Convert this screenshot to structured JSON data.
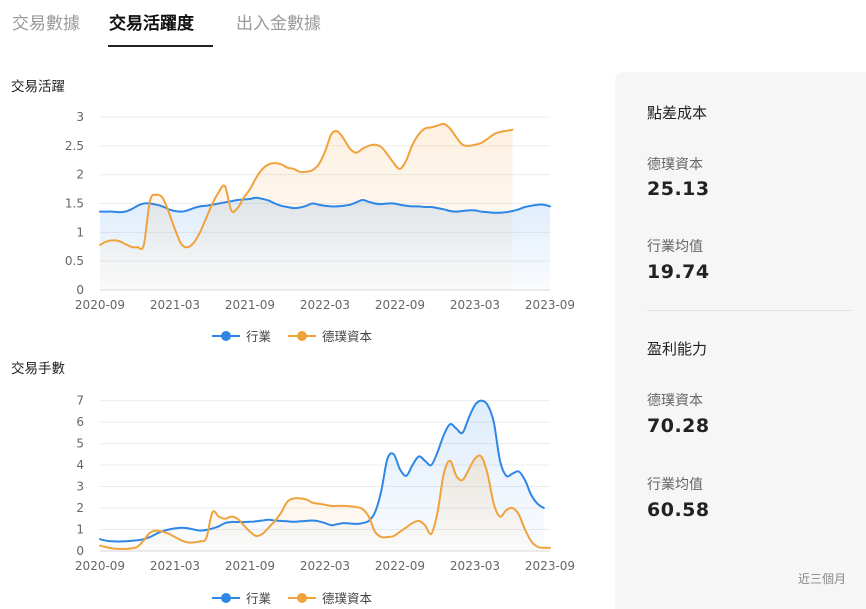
{
  "tabs": [
    {
      "label": "交易數據",
      "active": false
    },
    {
      "label": "交易活躍度",
      "active": true
    },
    {
      "label": "出入金數據",
      "active": false
    }
  ],
  "colors": {
    "industry": "#2e86e6",
    "company": "#f0a23c"
  },
  "charts": {
    "activity": {
      "title": "交易活躍"
    },
    "trades": {
      "title": "交易手數"
    }
  },
  "legend": {
    "industry": "行業",
    "company": "德璞資本"
  },
  "panel": {
    "spread": {
      "heading": "點差成本",
      "company_label": "德璞資本",
      "company_value": "25.13",
      "industry_label": "行業均值",
      "industry_value": "19.74"
    },
    "profit": {
      "heading": "盈利能力",
      "company_label": "德璞資本",
      "company_value": "70.28",
      "industry_label": "行業均值",
      "industry_value": "60.58"
    },
    "footer": "近三個月"
  },
  "chart_data": [
    {
      "type": "area",
      "title": "交易活躍",
      "x_ticks": [
        "2020-09",
        "2021-03",
        "2021-09",
        "2022-03",
        "2022-09",
        "2023-03",
        "2023-09"
      ],
      "y_ticks": [
        0,
        0.5,
        1,
        1.5,
        2,
        2.5,
        3
      ],
      "ylim": [
        0,
        3
      ],
      "x": [
        0,
        0.5,
        1,
        1.5,
        2,
        2.5,
        3,
        3.5,
        4,
        4.5,
        5,
        5.5,
        6,
        6.5,
        7,
        7.5,
        8,
        8.5,
        9,
        9.5,
        10,
        10.5,
        11,
        11.5,
        12,
        12.5,
        13,
        13.5,
        14,
        14.5,
        15,
        15.5,
        16,
        16.5,
        17,
        17.5,
        18,
        18.5,
        19,
        19.5,
        20,
        20.5,
        21,
        21.5,
        22,
        22.5,
        23,
        23.5,
        24,
        24.5,
        25,
        25.5,
        26,
        26.5,
        27,
        27.5,
        28,
        28.5,
        29,
        29.5,
        30,
        30.5,
        31,
        31.5,
        32,
        32.5,
        33,
        33.5,
        34,
        34.5,
        35,
        35.5,
        36
      ],
      "series": [
        {
          "name": "行業",
          "values": [
            1.36,
            1.36,
            1.36,
            1.35,
            1.36,
            1.4,
            1.46,
            1.5,
            1.5,
            1.48,
            1.45,
            1.4,
            1.37,
            1.36,
            1.38,
            1.42,
            1.45,
            1.46,
            1.48,
            1.5,
            1.52,
            1.54,
            1.56,
            1.57,
            1.58,
            1.6,
            1.58,
            1.55,
            1.5,
            1.46,
            1.44,
            1.42,
            1.43,
            1.46,
            1.5,
            1.48,
            1.46,
            1.45,
            1.45,
            1.46,
            1.48,
            1.52,
            1.56,
            1.53,
            1.5,
            1.49,
            1.5,
            1.5,
            1.48,
            1.46,
            1.45,
            1.45,
            1.44,
            1.44,
            1.42,
            1.4,
            1.37,
            1.36,
            1.37,
            1.38,
            1.38,
            1.36,
            1.35,
            1.34,
            1.34,
            1.35,
            1.37,
            1.4,
            1.44,
            1.46,
            1.48,
            1.48,
            1.45
          ]
        },
        {
          "name": "德璞資本",
          "values": [
            0.78,
            0.84,
            0.86,
            0.85,
            0.8,
            0.75,
            0.74,
            0.78,
            1.55,
            1.65,
            1.6,
            1.35,
            1.05,
            0.8,
            0.74,
            0.82,
            1.0,
            1.25,
            1.5,
            1.7,
            1.8,
            1.38,
            1.42,
            1.6,
            1.75,
            1.95,
            2.1,
            2.18,
            2.2,
            2.18,
            2.12,
            2.1,
            2.05,
            2.05,
            2.08,
            2.18,
            2.4,
            2.7,
            2.75,
            2.62,
            2.45,
            2.38,
            2.45,
            2.5,
            2.52,
            2.48,
            2.35,
            2.2,
            2.1,
            2.25,
            2.52,
            2.7,
            2.8,
            2.82,
            2.85,
            2.88,
            2.8,
            2.65,
            2.52,
            2.5,
            2.52,
            2.55,
            2.62,
            2.7,
            2.74,
            2.76,
            2.78
          ]
        }
      ]
    },
    {
      "type": "area",
      "title": "交易手數",
      "x_ticks": [
        "2020-09",
        "2021-03",
        "2021-09",
        "2022-03",
        "2022-09",
        "2023-03",
        "2023-09"
      ],
      "y_ticks": [
        0,
        1,
        2,
        3,
        4,
        5,
        6,
        7
      ],
      "ylim": [
        0,
        7.4
      ],
      "x": [
        0,
        0.5,
        1,
        1.5,
        2,
        2.5,
        3,
        3.5,
        4,
        4.5,
        5,
        5.5,
        6,
        6.5,
        7,
        7.5,
        8,
        8.5,
        9,
        9.5,
        10,
        10.5,
        11,
        11.5,
        12,
        12.5,
        13,
        13.5,
        14,
        14.5,
        15,
        15.5,
        16,
        16.5,
        17,
        17.5,
        18,
        18.5,
        19,
        19.5,
        20,
        20.5,
        21,
        21.5,
        22,
        22.5,
        23,
        23.5,
        24,
        24.5,
        25,
        25.5,
        26,
        26.5,
        27,
        27.5,
        28,
        28.5,
        29,
        29.5,
        30,
        30.5,
        31,
        31.5,
        32,
        32.5,
        33,
        33.5,
        34,
        34.5,
        35,
        35.5,
        36
      ],
      "series": [
        {
          "name": "行業",
          "values": [
            0.55,
            0.48,
            0.45,
            0.44,
            0.45,
            0.47,
            0.5,
            0.55,
            0.65,
            0.8,
            0.92,
            1.0,
            1.05,
            1.08,
            1.06,
            1.0,
            0.95,
            0.98,
            1.05,
            1.15,
            1.3,
            1.35,
            1.35,
            1.35,
            1.36,
            1.38,
            1.42,
            1.45,
            1.42,
            1.4,
            1.38,
            1.36,
            1.38,
            1.4,
            1.42,
            1.38,
            1.3,
            1.2,
            1.25,
            1.3,
            1.28,
            1.26,
            1.3,
            1.4,
            1.8,
            2.8,
            4.3,
            4.5,
            3.8,
            3.5,
            4.0,
            4.4,
            4.2,
            4.0,
            4.6,
            5.4,
            5.9,
            5.7,
            5.5,
            6.2,
            6.8,
            7.0,
            6.8,
            6.0,
            4.2,
            3.5,
            3.6,
            3.7,
            3.3,
            2.6,
            2.2,
            2.0
          ]
        },
        {
          "name": "德璞資本",
          "values": [
            0.25,
            0.18,
            0.12,
            0.1,
            0.1,
            0.12,
            0.2,
            0.5,
            0.85,
            0.95,
            0.9,
            0.8,
            0.65,
            0.5,
            0.4,
            0.4,
            0.45,
            0.6,
            1.8,
            1.6,
            1.5,
            1.6,
            1.5,
            1.2,
            0.9,
            0.7,
            0.8,
            1.1,
            1.4,
            1.8,
            2.3,
            2.45,
            2.45,
            2.4,
            2.25,
            2.2,
            2.15,
            2.1,
            2.1,
            2.1,
            2.08,
            2.05,
            1.95,
            1.6,
            0.9,
            0.65,
            0.65,
            0.7,
            0.9,
            1.1,
            1.3,
            1.4,
            1.2,
            0.8,
            1.8,
            3.6,
            4.2,
            3.5,
            3.3,
            3.8,
            4.3,
            4.4,
            3.6,
            2.2,
            1.6,
            1.9,
            2.0,
            1.7,
            1.0,
            0.45,
            0.2,
            0.15,
            0.15
          ]
        }
      ]
    }
  ]
}
